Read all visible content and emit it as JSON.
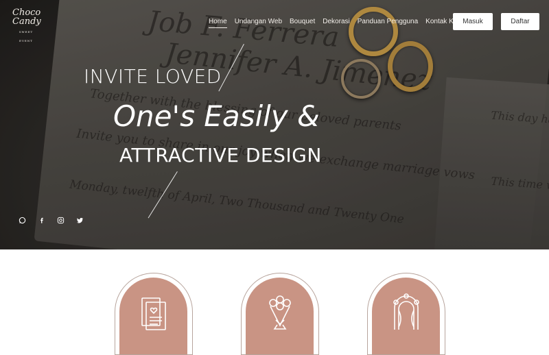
{
  "logo": {
    "line1": "Choco",
    "line2": "Candy",
    "tagline": "SWEET EVENT"
  },
  "nav": {
    "items": [
      "Home",
      "Undangan Web",
      "Bouquet",
      "Dekorasi",
      "Panduan Pengguna",
      "Kontak Kami"
    ],
    "active": "Home"
  },
  "auth": {
    "login_label": "Masuk",
    "register_label": "Daftar"
  },
  "hero": {
    "line1": "INVITE LOVED",
    "line2": "One's Easily &",
    "line3": "ATTRACTIVE DESIGN",
    "background_text": {
      "names": "Job F. Ferrera",
      "names2": "Jennifer A. Jimenez",
      "invite": "Together with the blessing of our beloved parents",
      "body": "Invite you to share in our joy when we exchange marriage vows",
      "date": "Monday, twelfth of April, Two Thousand and Twenty One",
      "side1": "This day has of walking be my bes man t",
      "side2": "This time w together, home bec And now I our new pa"
    }
  },
  "social": [
    "whatsapp-icon",
    "facebook-icon",
    "instagram-icon",
    "twitter-icon"
  ],
  "features": [
    {
      "icon": "invitation-card-icon"
    },
    {
      "icon": "bouquet-icon"
    },
    {
      "icon": "wedding-arch-icon"
    }
  ],
  "colors": {
    "accent": "#c99484",
    "arch_border": "#b7a49c",
    "nav_text": "#f3efea"
  }
}
